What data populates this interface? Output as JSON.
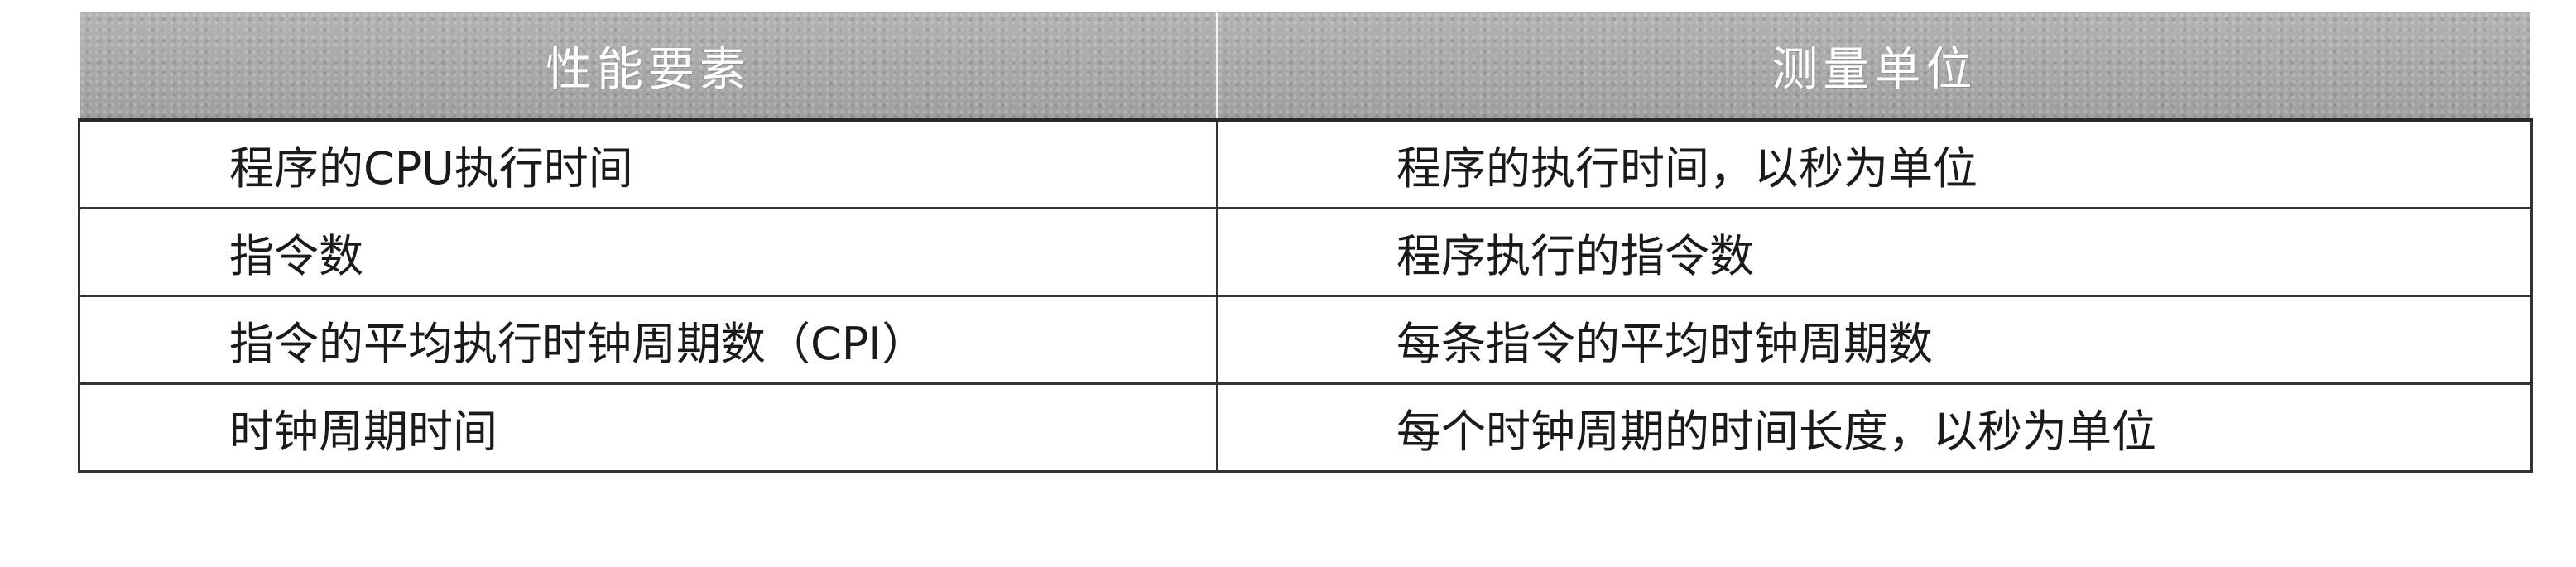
{
  "table": {
    "headers": [
      "性能要素",
      "测量单位"
    ],
    "rows": [
      [
        "程序的CPU执行时间",
        "程序的执行时间，以秒为单位"
      ],
      [
        "指令数",
        "程序执行的指令数"
      ],
      [
        "指令的平均执行时钟周期数（CPI）",
        "每条指令的平均时钟周期数"
      ],
      [
        "时钟周期时间",
        "每个时钟周期的时间长度，以秒为单位"
      ]
    ]
  },
  "colors": {
    "header_bg": "#a9a9a9",
    "header_text": "#ffffff",
    "border": "#333333",
    "body_text": "#1a1a1a"
  }
}
